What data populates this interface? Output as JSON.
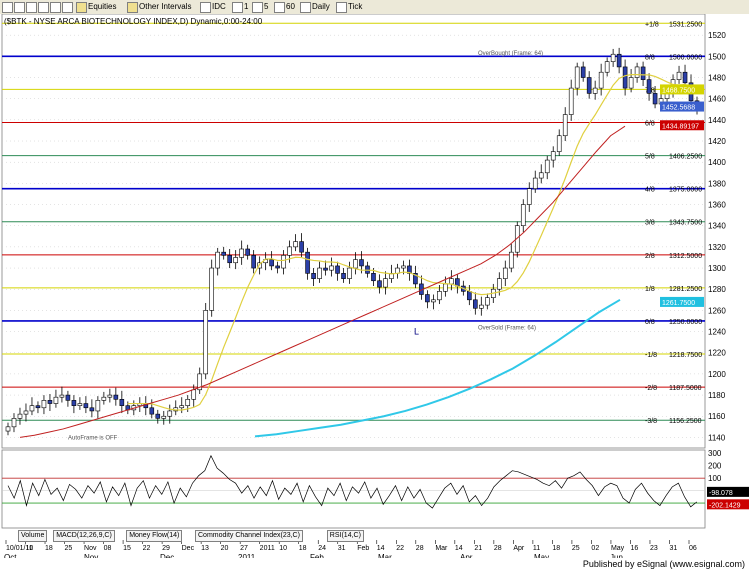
{
  "toolbar": {
    "items": [
      {
        "id": "equities",
        "label": "Equities"
      },
      {
        "id": "other-intervals",
        "label": "Other Intervals"
      },
      {
        "id": "idc",
        "label": "IDC"
      },
      {
        "id": "one",
        "label": "1"
      },
      {
        "id": "five",
        "label": "5"
      },
      {
        "id": "sixty",
        "label": "60"
      },
      {
        "id": "daily",
        "label": "Daily"
      },
      {
        "id": "tick",
        "label": "Tick"
      }
    ]
  },
  "chart_data": [
    {
      "type": "candlestick",
      "title": "($BTK - NYSE ARCA BIOTECHNOLOGY INDEX,D) Dynamic,0:00-24:00",
      "ylim": [
        1130,
        1540
      ],
      "y_ticks": [
        1140,
        1160,
        1180,
        1200,
        1220,
        1240,
        1260,
        1280,
        1300,
        1320,
        1340,
        1360,
        1380,
        1400,
        1420,
        1440,
        1460,
        1480,
        1500,
        1520
      ],
      "x_ticks": [
        "10/01/10",
        "11",
        "18",
        "25",
        "Nov",
        "08",
        "15",
        "22",
        "29",
        "Dec",
        "13",
        "20",
        "27",
        "2011",
        "10",
        "18",
        "24",
        "31",
        "Feb",
        "14",
        "22",
        "28",
        "Mar",
        "14",
        "21",
        "28",
        "Apr",
        "11",
        "18",
        "25",
        "02",
        "May",
        "16",
        "23",
        "31",
        "06",
        "Oct",
        "Jun"
      ],
      "month_labels": [
        "Oct",
        "Nov",
        "Dec",
        "2011",
        "Feb",
        "Mar",
        "Apr",
        "May",
        "Jun"
      ],
      "murrey_lines": [
        {
          "label": "+1/8",
          "value": 1531.25,
          "color": "#d4d400"
        },
        {
          "label": "8/8",
          "value": 1500.0,
          "color": "#0000cc"
        },
        {
          "label": "7/8",
          "value": 1468.75,
          "color": "#d4d400"
        },
        {
          "label": "6/8",
          "value": 1437.5,
          "color": "#cc0000"
        },
        {
          "label": "5/8",
          "value": 1406.25,
          "color": "#2e8b57"
        },
        {
          "label": "4/8",
          "value": 1375.0,
          "color": "#0000cc"
        },
        {
          "label": "3/8",
          "value": 1343.75,
          "color": "#2e8b57"
        },
        {
          "label": "2/8",
          "value": 1312.5,
          "color": "#cc0000"
        },
        {
          "label": "1/8",
          "value": 1281.25,
          "color": "#d4d400"
        },
        {
          "label": "0/8",
          "value": 1250.0,
          "color": "#0000cc"
        },
        {
          "label": "-1/8",
          "value": 1218.75,
          "color": "#d4d400"
        },
        {
          "label": "-2/8",
          "value": 1187.5,
          "color": "#cc0000"
        },
        {
          "label": "-3/8",
          "value": 1156.25,
          "color": "#2e8b57"
        }
      ],
      "axis_value_labels": [
        "1531.2500",
        "1500.0000",
        "1468.7500",
        "1437.5000",
        "1406.2500",
        "1375.0000",
        "1343.7500",
        "1312.5000",
        "1281.2500",
        "1250.0000",
        "1218.7500",
        "1187.5000",
        "1156.2500"
      ],
      "price_tags": [
        {
          "label": "1452.5688",
          "value": 1452.57,
          "color": "#3a5fcd"
        },
        {
          "label": "1434.89197",
          "value": 1434.89,
          "color": "#cc0000"
        },
        {
          "label": "1468.7500",
          "value": 1468.75,
          "color": "#d4d400"
        },
        {
          "label": "1261.7500",
          "value": 1268.0,
          "color": "#20c0e0"
        }
      ],
      "annotations": [
        {
          "text": "OverBought (Frame: 64)",
          "value": 1504
        },
        {
          "text": "OverSold (Frame: 64)",
          "value": 1245
        },
        {
          "text": "AutoFrame is OFF",
          "value": 1141
        },
        {
          "text": "L",
          "value": 1240
        }
      ],
      "closes": [
        1150,
        1158,
        1162,
        1165,
        1170,
        1168,
        1175,
        1172,
        1178,
        1180,
        1175,
        1170,
        1172,
        1168,
        1165,
        1175,
        1178,
        1180,
        1176,
        1170,
        1166,
        1170,
        1172,
        1168,
        1162,
        1158,
        1160,
        1165,
        1168,
        1170,
        1176,
        1185,
        1200,
        1260,
        1300,
        1315,
        1312,
        1305,
        1310,
        1318,
        1312,
        1300,
        1305,
        1308,
        1302,
        1300,
        1312,
        1320,
        1325,
        1315,
        1295,
        1290,
        1300,
        1298,
        1302,
        1295,
        1290,
        1300,
        1308,
        1302,
        1295,
        1288,
        1282,
        1290,
        1295,
        1300,
        1302,
        1295,
        1285,
        1275,
        1268,
        1270,
        1278,
        1285,
        1290,
        1283,
        1278,
        1270,
        1262,
        1265,
        1272,
        1280,
        1290,
        1300,
        1315,
        1340,
        1360,
        1375,
        1385,
        1390,
        1402,
        1410,
        1425,
        1445,
        1470,
        1490,
        1480,
        1465,
        1470,
        1485,
        1495,
        1502,
        1490,
        1470,
        1480,
        1490,
        1478,
        1465,
        1455,
        1460,
        1468,
        1478,
        1485,
        1475,
        1458,
        1452
      ],
      "sma_slow": [
        1140,
        1142,
        1145,
        1148,
        1152,
        1156,
        1160,
        1164,
        1168,
        1172,
        1176,
        1180,
        1185,
        1190,
        1196,
        1202,
        1208,
        1214,
        1220,
        1226,
        1232,
        1238,
        1244,
        1250,
        1256,
        1262,
        1268,
        1274,
        1280,
        1286,
        1292,
        1298,
        1304,
        1312,
        1322,
        1334,
        1348,
        1362,
        1378,
        1394,
        1410,
        1425,
        1434
      ],
      "sma_cyan": [
        1141,
        1143,
        1146,
        1149,
        1152,
        1156,
        1160,
        1165,
        1171,
        1178,
        1186,
        1195,
        1205,
        1217,
        1230,
        1244,
        1258,
        1270
      ],
      "cci": {
        "ylim": [
          -300,
          310
        ],
        "y_ticks": [
          300,
          200,
          100,
          0,
          -100
        ],
        "bands": [
          100,
          -100
        ],
        "last_values": [
          {
            "label": "-98.078",
            "color": "#ffffff",
            "bg": "#000000"
          },
          {
            "label": "-202.1429",
            "color": "#ffffff",
            "bg": "#cc0000"
          }
        ],
        "values": [
          40,
          -60,
          80,
          -120,
          60,
          -40,
          90,
          -30,
          20,
          -80,
          50,
          10,
          -60,
          40,
          -20,
          70,
          -90,
          30,
          -40,
          60,
          -120,
          20,
          80,
          -60,
          40,
          -30,
          70,
          -100,
          20,
          -50,
          60,
          120,
          160,
          280,
          180,
          140,
          90,
          60,
          -20,
          40,
          -60,
          30,
          -40,
          80,
          -70,
          20,
          -30,
          60,
          -90,
          40,
          -50,
          -120,
          20,
          -40,
          60,
          -80,
          30,
          -20,
          70,
          -60,
          20,
          -110,
          -40,
          40,
          -80,
          30,
          -60,
          10,
          -100,
          -140,
          -60,
          20,
          60,
          -30,
          40,
          -90,
          -40,
          -120,
          -60,
          30,
          80,
          120,
          160,
          150,
          130,
          110,
          90,
          60,
          40,
          80,
          20,
          100,
          120,
          150,
          90,
          40,
          -40,
          30,
          60,
          40,
          -60,
          -100,
          10,
          60,
          -20,
          -80,
          -120,
          -40,
          30,
          60,
          -50,
          -130,
          -90
        ]
      },
      "indicator_tabs": [
        "Volume",
        "MACD(12,26,9,C)",
        "Money Flow(14)",
        "Commodity Channel Index(23,C)",
        "RSI(14,C)"
      ]
    }
  ],
  "footer": {
    "published": "Published by eSignal (www.esignal.com)"
  }
}
